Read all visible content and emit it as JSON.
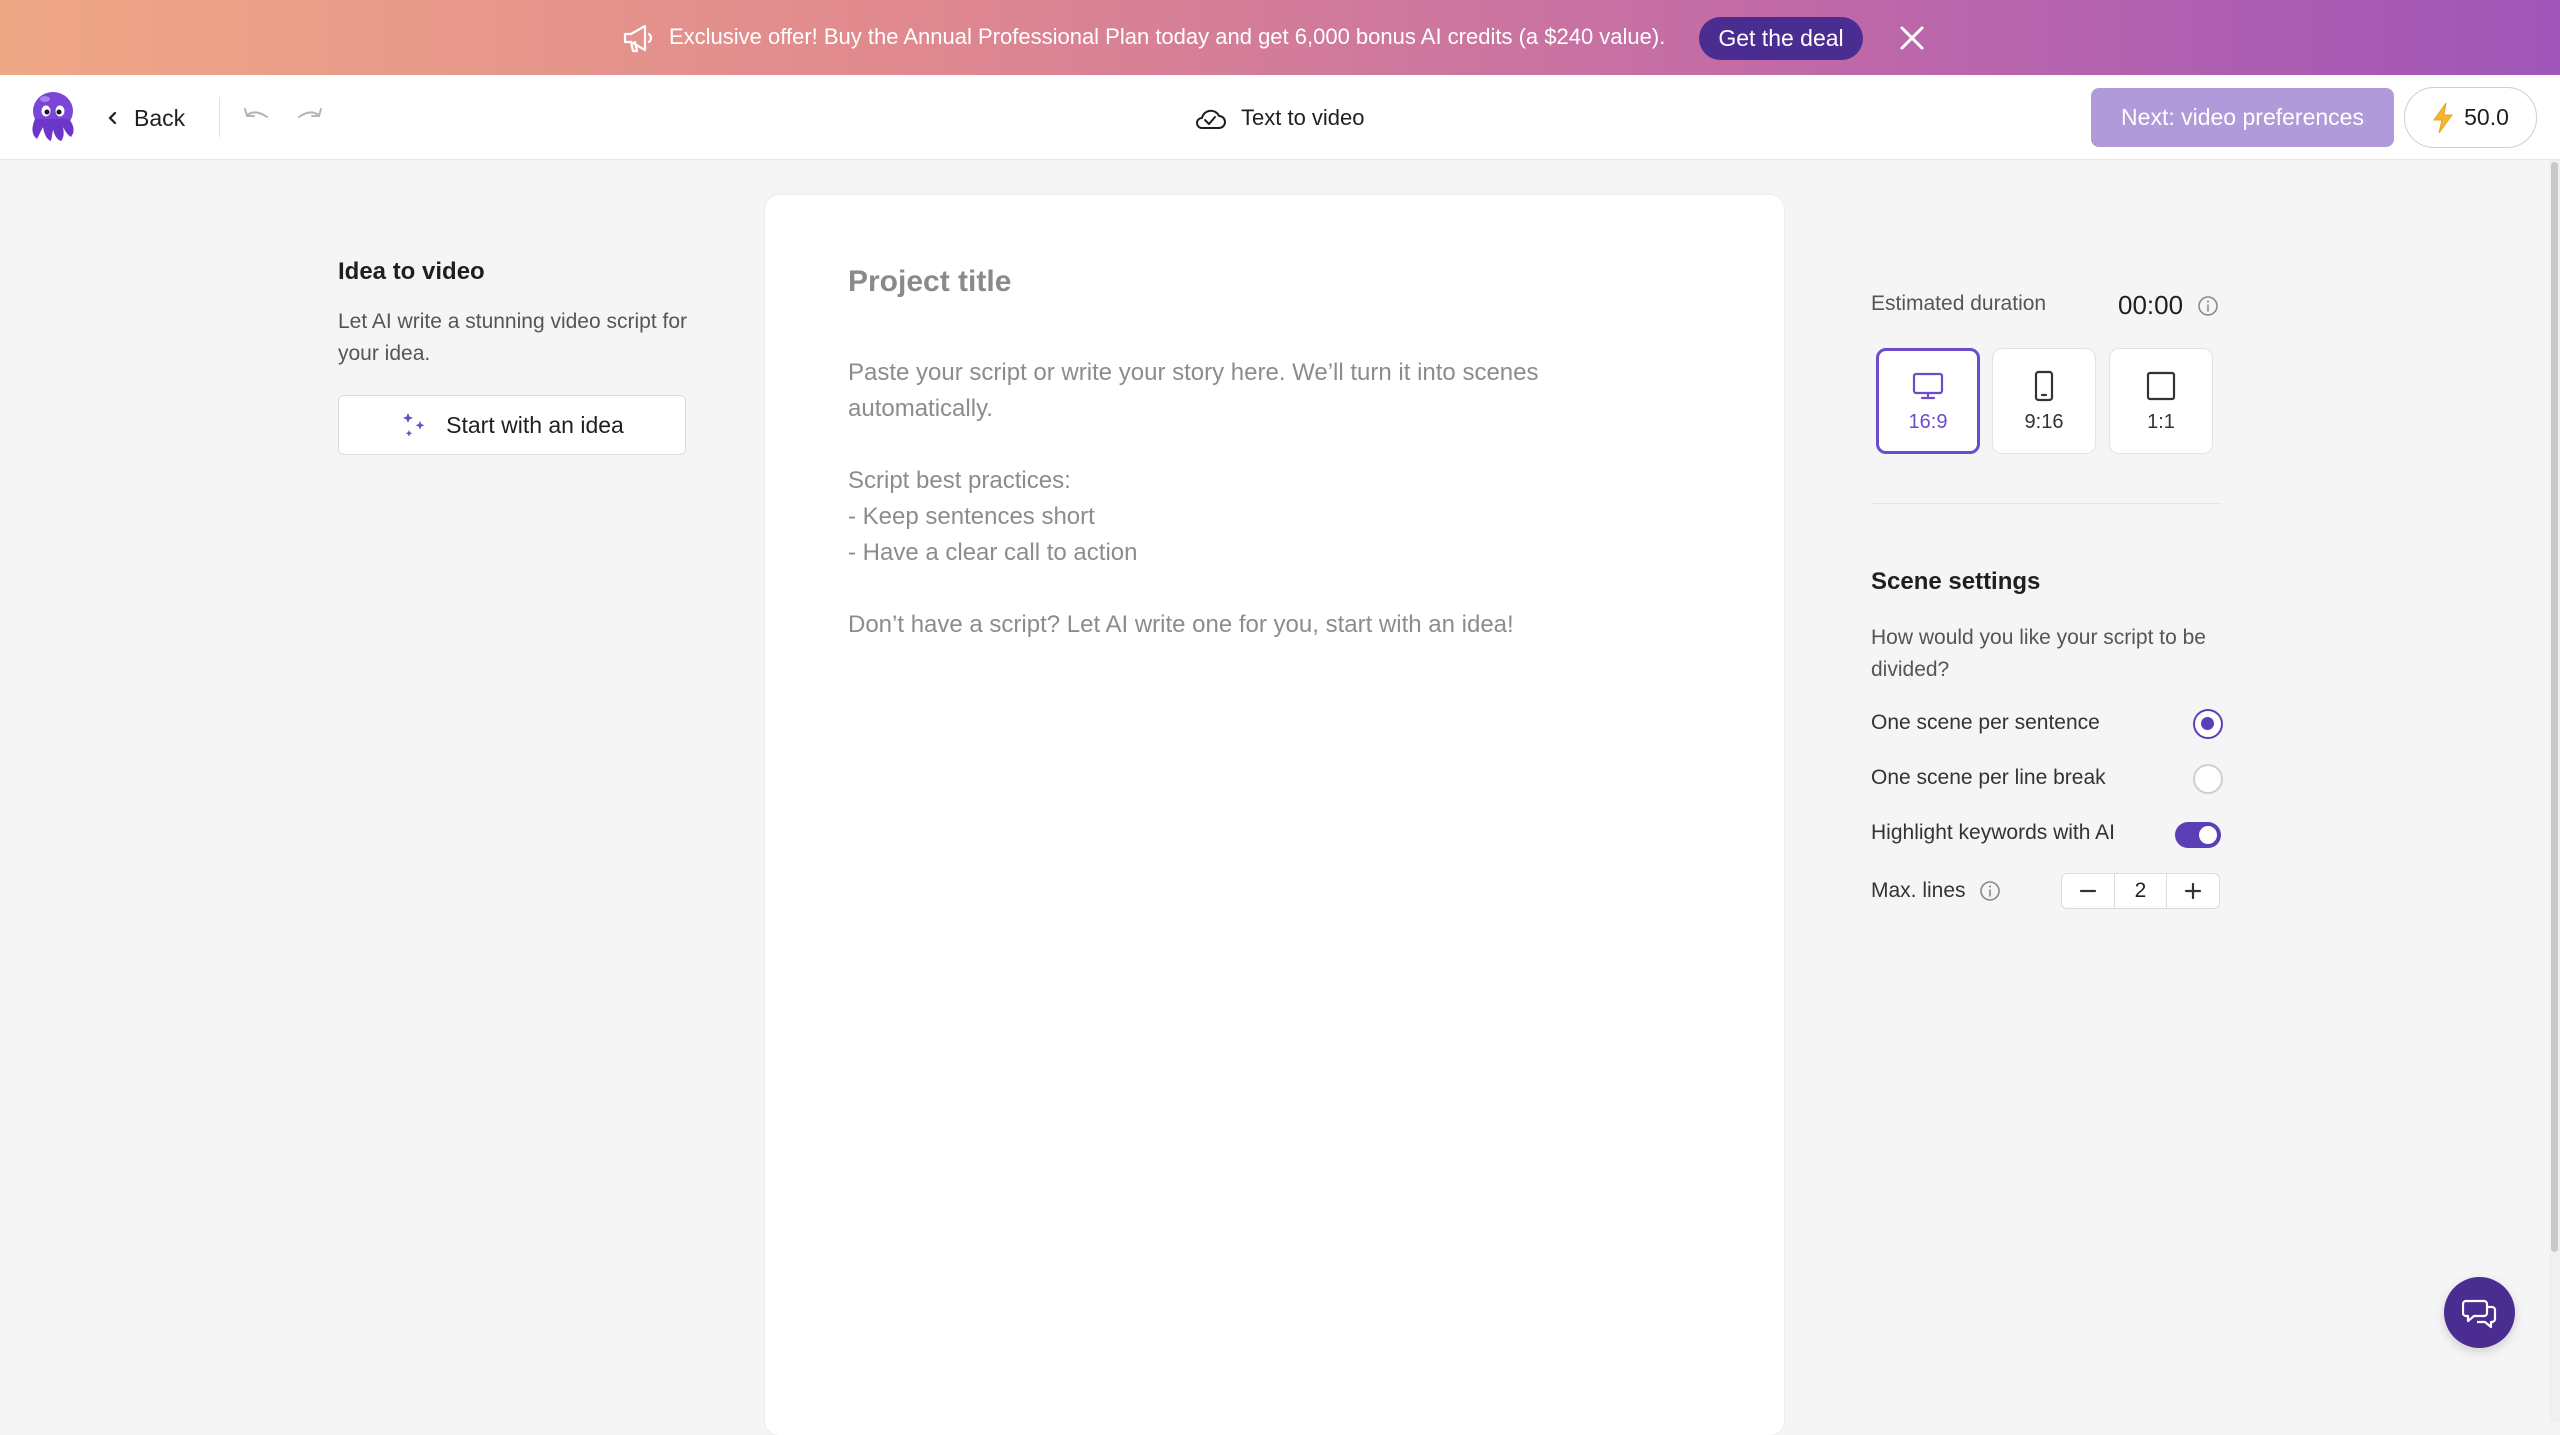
{
  "banner": {
    "text": "Exclusive offer! Buy the Annual Professional Plan today and get 6,000 bonus AI credits (a $240 value).",
    "cta_label": "Get the deal",
    "icon": "megaphone-icon",
    "close_icon": "close-icon"
  },
  "topbar": {
    "back_label": "Back",
    "title": "Text to video",
    "title_icon": "cloud-check-icon",
    "next_label": "Next: video preferences",
    "credits": "50.0",
    "credits_icon": "lightning-icon"
  },
  "left_panel": {
    "title": "Idea to video",
    "description": "Let AI write a stunning video script for your idea.",
    "button_label": "Start with an idea",
    "button_icon": "sparkle-icon"
  },
  "editor": {
    "title_placeholder": "Project title",
    "script_placeholder": "Paste your script or write your story here. We’ll turn it into scenes automatically.\n\nScript best practices:\n- Keep sentences short\n- Have a clear call to action\n\nDon’t have a script? Let AI write one for you, start with an idea!"
  },
  "right_panel": {
    "estimated_label": "Estimated duration",
    "estimated_value": "00:00",
    "aspect_ratios": [
      {
        "label": "16:9",
        "icon": "monitor-icon",
        "selected": true
      },
      {
        "label": "9:16",
        "icon": "phone-icon",
        "selected": false
      },
      {
        "label": "1:1",
        "icon": "square-icon",
        "selected": false
      }
    ],
    "scene_title": "Scene settings",
    "scene_question": "How would you like your script to be divided?",
    "option_sentence": "One scene per sentence",
    "option_linebreak": "One scene per line break",
    "selected_option": "One scene per sentence",
    "highlight_label": "Highlight keywords with AI",
    "highlight_enabled": true,
    "max_lines_label": "Max. lines",
    "max_lines_value": "2"
  },
  "colors": {
    "accent": "#5b3fb6",
    "deal_button": "#4b2d92",
    "next_button": "#b19ad9",
    "banner_gradient_start": "#efa886",
    "banner_gradient_end": "#9f56b8"
  }
}
